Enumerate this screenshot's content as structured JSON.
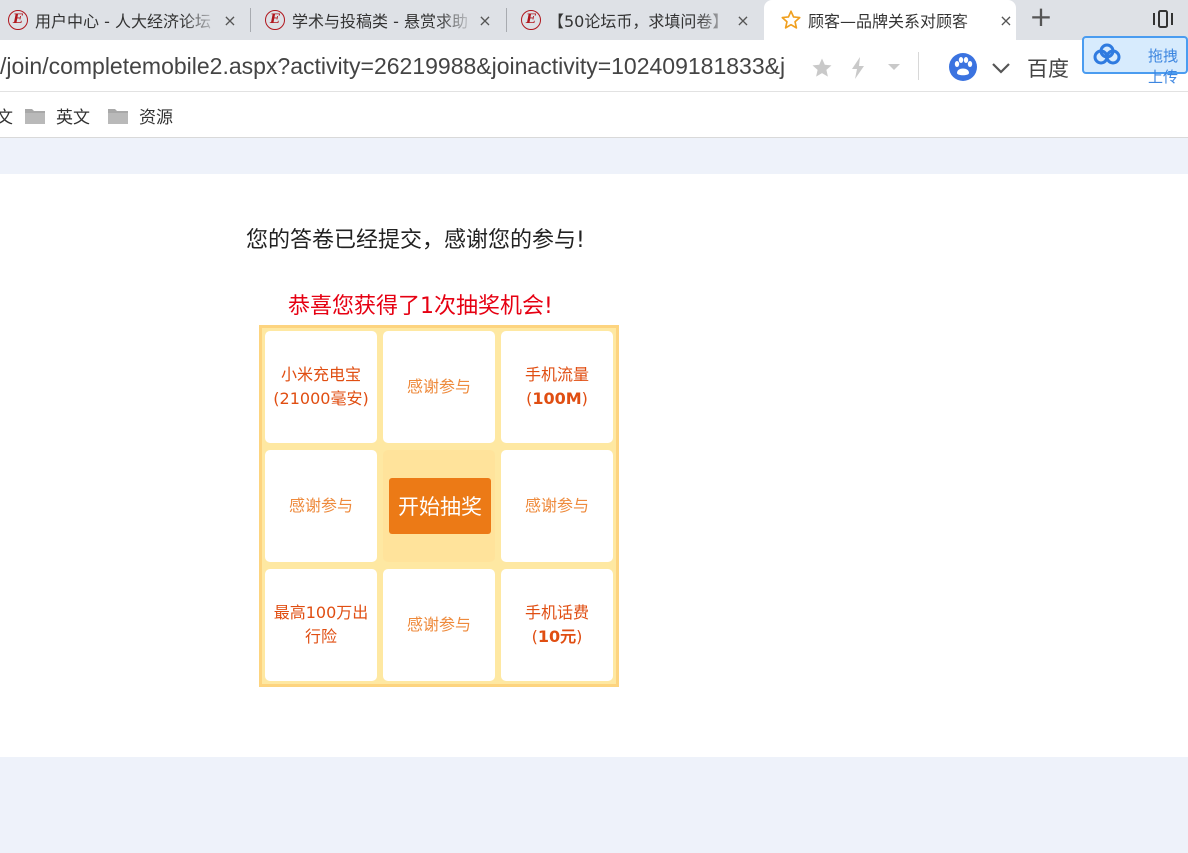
{
  "browser": {
    "tabs": [
      {
        "title": "用户中心 - 人大经济论坛",
        "close": "×",
        "favicon": "E"
      },
      {
        "title": "学术与投稿类 - 悬赏求助",
        "close": "×",
        "favicon": "E"
      },
      {
        "title": "【50论坛币，求填问卷】",
        "close": "×",
        "favicon": "E"
      },
      {
        "title": "顾客—品牌关系对顾客",
        "close": "×",
        "favicon": "star"
      }
    ],
    "new_tab": "+",
    "address": "/join/completemobile2.aspx?activity=26219988&joinactivity=102409181833&j",
    "search_engine": "百度",
    "cloud_widget_label": "拖拽上传",
    "bookmarks": [
      {
        "label": "文"
      },
      {
        "label": "英文"
      },
      {
        "label": "资源"
      }
    ]
  },
  "page": {
    "thanks_message": "您的答卷已经提交，感谢您的参与!",
    "congrats_message": "恭喜您获得了1次抽奖机会!",
    "lottery": {
      "start_button": "开始抽奖",
      "cells": [
        {
          "line1": "小米充电宝",
          "line2": "(21000毫安)"
        },
        {
          "line1": "感谢参与"
        },
        {
          "line1": "手机流量",
          "line2_pre": "(",
          "line2_bold": "100M",
          "line2_post": ")"
        },
        {
          "line1": "感谢参与"
        },
        {
          "line1": "感谢参与"
        },
        {
          "line1": "最高100万出",
          "line2": "行险"
        },
        {
          "line1": "感谢参与"
        },
        {
          "line1": "手机话费",
          "line2_pre": "(",
          "line2_bold": "10元",
          "line2_post": ")"
        }
      ]
    }
  },
  "colors": {
    "prize_text": "#e04e12",
    "thanks_text": "#ee8a3c",
    "congrats_text": "#e60012",
    "start_button_bg": "#ec7a16",
    "board_bg": "#fee8a2"
  }
}
